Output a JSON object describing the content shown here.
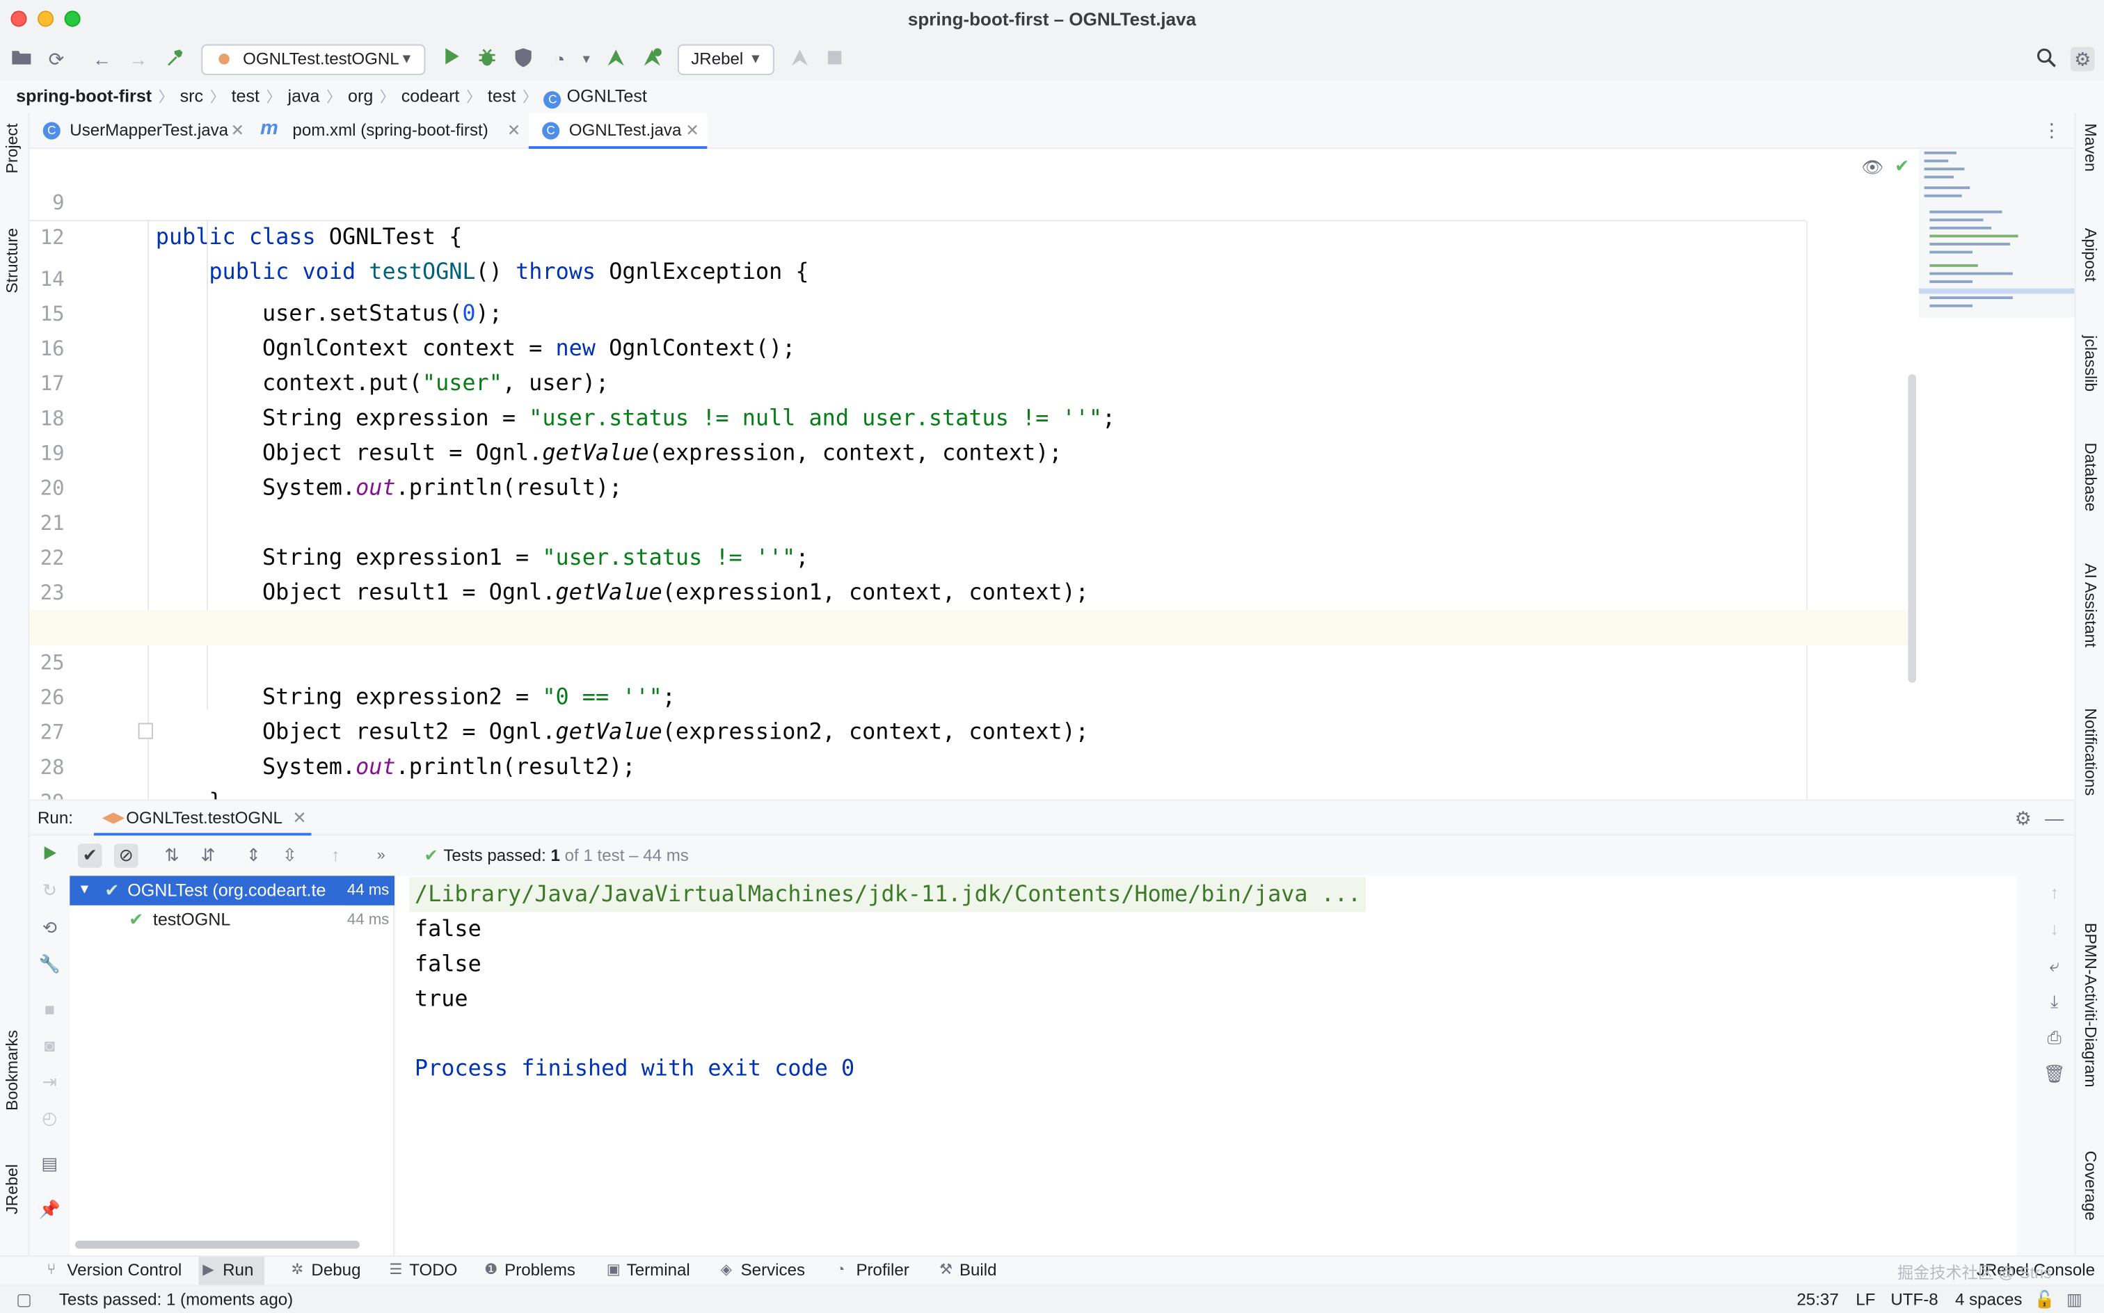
{
  "window": {
    "title": "spring-boot-first – OGNLTest.java"
  },
  "toolbar": {
    "run_config": "OGNLTest.testOGNL",
    "jrebel_select": "JRebel"
  },
  "breadcrumb": [
    "spring-boot-first",
    "src",
    "test",
    "java",
    "org",
    "codeart",
    "test",
    "OGNLTest"
  ],
  "left_tools": {
    "project": "Project",
    "structure": "Structure",
    "bookmarks": "Bookmarks",
    "jrebel": "JRebel"
  },
  "right_tools": [
    "Maven",
    "Apipost",
    "jclasslib",
    "Database",
    "AI Assistant",
    "Notifications",
    "BPMN-Activiti-Diagram",
    "Coverage"
  ],
  "tabs": [
    {
      "label": "UserMapperTest.java",
      "icon": "class-icon"
    },
    {
      "label": "pom.xml (spring-boot-first)",
      "icon": "maven-icon"
    },
    {
      "label": "OGNLTest.java",
      "icon": "class-icon",
      "active": true
    }
  ],
  "editor": {
    "sticky": [
      {
        "line": "9",
        "text": "public class OGNLTest {"
      },
      {
        "line": "12",
        "text": "    public void testOGNL() throws OgnlException {"
      }
    ],
    "lines": [
      {
        "line": "14",
        "text": "        user.setStatus(0);"
      },
      {
        "line": "15",
        "text": "        OgnlContext context = new OgnlContext();"
      },
      {
        "line": "16",
        "text": "        context.put(\"user\", user);"
      },
      {
        "line": "17",
        "text": "        String expression = \"user.status != null and user.status != ''\";"
      },
      {
        "line": "18",
        "text": "        Object result = Ognl.getValue(expression, context, context);"
      },
      {
        "line": "19",
        "text": "        System.out.println(result);"
      },
      {
        "line": "20",
        "text": ""
      },
      {
        "line": "21",
        "text": "        String expression1 = \"user.status != ''\";"
      },
      {
        "line": "22",
        "text": "        Object result1 = Ognl.getValue(expression1, context, context);"
      },
      {
        "line": "23",
        "text": "        System.out.println(result1);"
      },
      {
        "line": "24",
        "text": ""
      },
      {
        "line": "25",
        "text": "        String expression2 = \"0 == ''\";"
      },
      {
        "line": "26",
        "text": "        Object result2 = Ognl.getValue(expression2, context, context);"
      },
      {
        "line": "27",
        "text": "        System.out.println(result2);"
      },
      {
        "line": "28",
        "text": "    }"
      },
      {
        "line": "29",
        "text": ""
      }
    ],
    "current_line": "25"
  },
  "run": {
    "label": "Run:",
    "tab": "OGNLTest.testOGNL",
    "status_prefix": "Tests passed:",
    "status_count": "1",
    "status_suffix": "of 1 test – 44 ms",
    "tree": [
      {
        "label": "OGNLTest (org.codeart.te",
        "time": "44 ms"
      },
      {
        "label": "testOGNL",
        "time": "44 ms"
      }
    ],
    "console": [
      "/Library/Java/JavaVirtualMachines/jdk-11.jdk/Contents/Home/bin/java ...",
      "false",
      "false",
      "true",
      "",
      "Process finished with exit code 0"
    ]
  },
  "bottom_tools": [
    "Version Control",
    "Run",
    "Debug",
    "TODO",
    "Problems",
    "Terminal",
    "Services",
    "Profiler",
    "Build"
  ],
  "status": {
    "message": "Tests passed: 1 (moments ago)",
    "position": "25:37",
    "line_sep": "LF",
    "encoding": "UTF-8",
    "indent": "4 spaces"
  },
  "watermark": "掘金技术社区 @ Stris",
  "jrebel_console": "JRebel Console"
}
